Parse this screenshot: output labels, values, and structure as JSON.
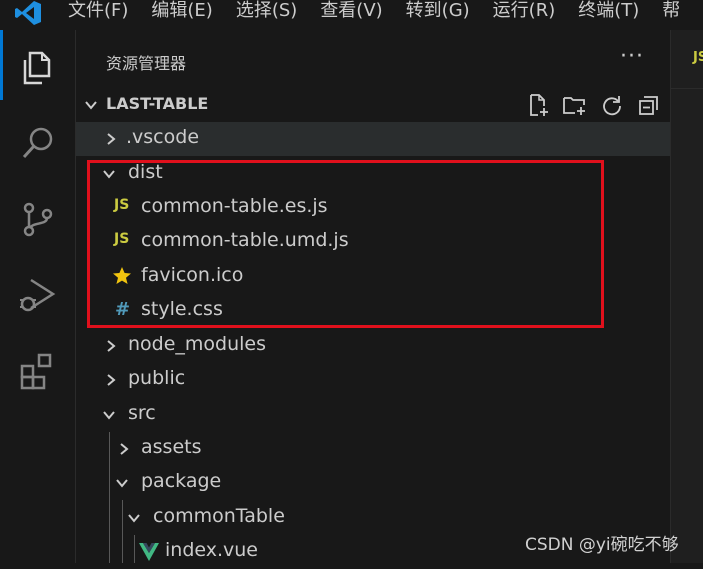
{
  "menubar": {
    "items": [
      "文件(F)",
      "编辑(E)",
      "选择(S)",
      "查看(V)",
      "转到(G)",
      "运行(R)",
      "终端(T)",
      "帮"
    ]
  },
  "sidebar": {
    "title": "资源管理器",
    "more": "···",
    "section": "LAST-TABLE",
    "tree": [
      {
        "name": ".vscode",
        "type": "folder",
        "expanded": false
      },
      {
        "name": "dist",
        "type": "folder",
        "expanded": true
      },
      {
        "name": "common-table.es.js",
        "type": "js",
        "icon": "JS"
      },
      {
        "name": "common-table.umd.js",
        "type": "js",
        "icon": "JS"
      },
      {
        "name": "favicon.ico",
        "type": "favicon"
      },
      {
        "name": "style.css",
        "type": "css",
        "icon": "#"
      },
      {
        "name": "node_modules",
        "type": "folder",
        "expanded": false
      },
      {
        "name": "public",
        "type": "folder",
        "expanded": false
      },
      {
        "name": "src",
        "type": "folder",
        "expanded": true
      },
      {
        "name": "assets",
        "type": "folder",
        "expanded": false
      },
      {
        "name": "package",
        "type": "folder",
        "expanded": true
      },
      {
        "name": "commonTable",
        "type": "folder",
        "expanded": true
      },
      {
        "name": "index.vue",
        "type": "vue"
      }
    ]
  },
  "editor": {
    "tab_icon": "JS"
  },
  "watermark": "CSDN @yi碗吃不够",
  "colors": {
    "accent": "#0078d4",
    "js": "#cbcb41",
    "css": "#519aba",
    "favicon": "#f1c40f",
    "vue": "#41b883",
    "highlight": "#e0101c"
  }
}
